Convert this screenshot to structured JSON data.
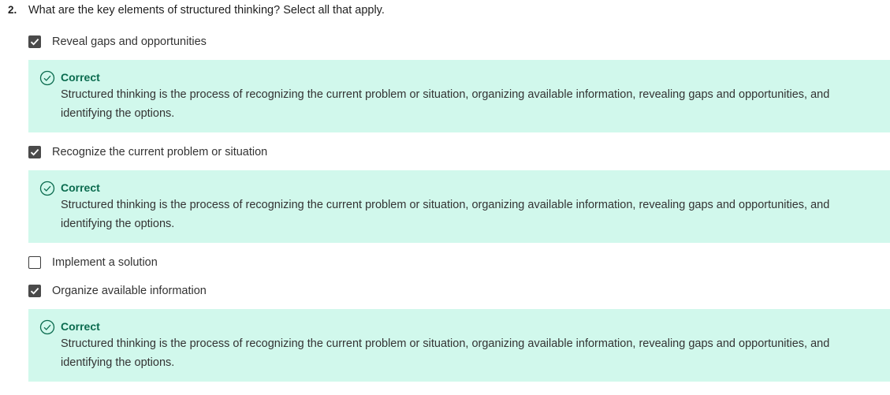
{
  "question": {
    "number": "2.",
    "text": "What are the key elements of structured thinking? Select all that apply."
  },
  "options": [
    {
      "label": "Reveal gaps and opportunities",
      "checked": true,
      "feedback": {
        "title": "Correct",
        "text": "Structured thinking is the process of recognizing the current problem or situation, organizing available information, revealing gaps and opportunities, and identifying the options."
      }
    },
    {
      "label": "Recognize the current problem or situation",
      "checked": true,
      "feedback": {
        "title": "Correct",
        "text": "Structured thinking is the process of recognizing the current problem or situation, organizing available information, revealing gaps and opportunities, and identifying the options."
      }
    },
    {
      "label": "Implement a solution",
      "checked": false
    },
    {
      "label": "Organize available information",
      "checked": true,
      "feedback": {
        "title": "Correct",
        "text": "Structured thinking is the process of recognizing the current problem or situation, organizing available information, revealing gaps and opportunities, and identifying the options."
      }
    }
  ],
  "colors": {
    "feedback_bg": "#d1f8ec",
    "correct_green": "#0a6b4e",
    "checkbox_checked": "#4a4a4a"
  },
  "icons": {
    "checkbox_checked": "checkmark-icon",
    "feedback": "check-circle-icon"
  }
}
